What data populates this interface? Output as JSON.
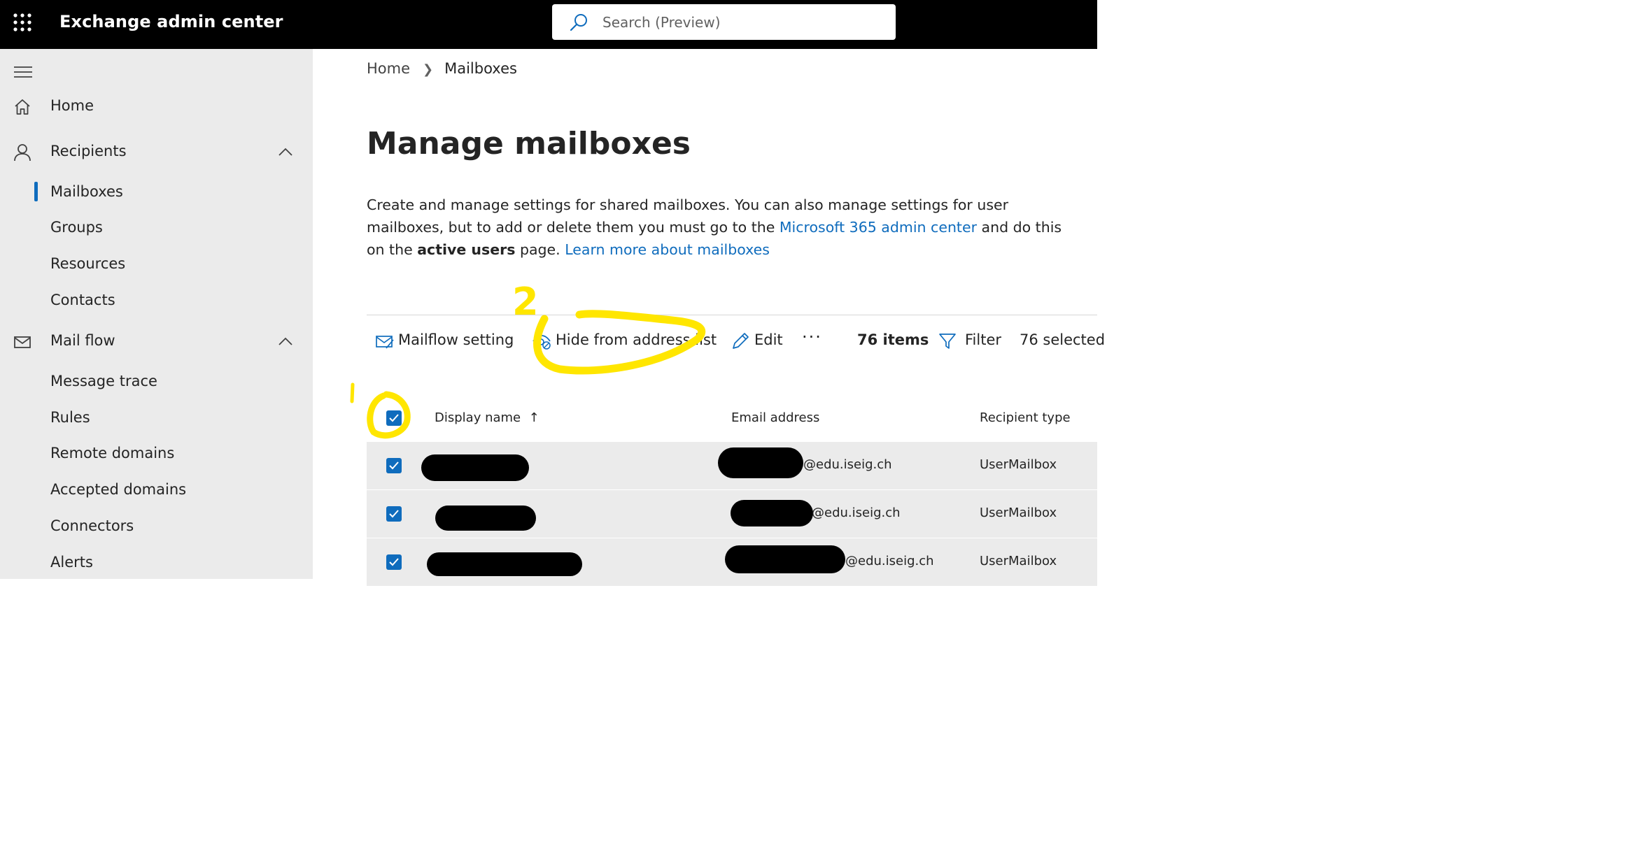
{
  "header": {
    "app_title": "Exchange admin center",
    "search_placeholder": "Search (Preview)"
  },
  "sidebar": {
    "items": [
      {
        "label": "Home",
        "icon": "home-icon"
      },
      {
        "label": "Recipients",
        "icon": "person-icon",
        "expanded": true
      },
      {
        "label": "Mail flow",
        "icon": "mail-icon",
        "expanded": true
      }
    ],
    "recipients_sub": [
      "Mailboxes",
      "Groups",
      "Resources",
      "Contacts"
    ],
    "mailflow_sub": [
      "Message trace",
      "Rules",
      "Remote domains",
      "Accepted domains",
      "Connectors",
      "Alerts"
    ],
    "active_item": "Mailboxes"
  },
  "breadcrumb": {
    "home": "Home",
    "current": "Mailboxes"
  },
  "page": {
    "title": "Manage mailboxes",
    "desc_part1": "Create and manage settings for shared mailboxes. You can also manage settings for user mailboxes, but to add or delete them you must go to the ",
    "desc_link1": "Microsoft 365 admin center",
    "desc_part2": " and do this on the ",
    "desc_bold": "active users",
    "desc_part3": " page. ",
    "desc_link2": "Learn more about mailboxes"
  },
  "toolbar": {
    "mailflow_setting": "Mailflow setting",
    "hide_from_address_list": "Hide from address list",
    "edit": "Edit",
    "more": "···",
    "items_count": "76 items",
    "filter": "Filter",
    "selected_count": "76 selected"
  },
  "table": {
    "columns": {
      "display_name": "Display name",
      "sort_arrow": "↑",
      "email": "Email address",
      "recipient_type": "Recipient type"
    },
    "rows": [
      {
        "email_suffix": "@edu.iseig.ch",
        "recipient_type": "UserMailbox",
        "checked": true
      },
      {
        "email_suffix": "@edu.iseig.ch",
        "recipient_type": "UserMailbox",
        "checked": true
      },
      {
        "email_suffix": "@edu.iseig.ch",
        "recipient_type": "UserMailbox",
        "checked": true
      }
    ]
  },
  "annotations": {
    "step2_label": "2"
  },
  "colors": {
    "topbar": "#000000",
    "sidebar": "#ebebeb",
    "accent": "#0f6cbd",
    "annotation": "#ffe600",
    "row_bg": "#ebebeb"
  }
}
